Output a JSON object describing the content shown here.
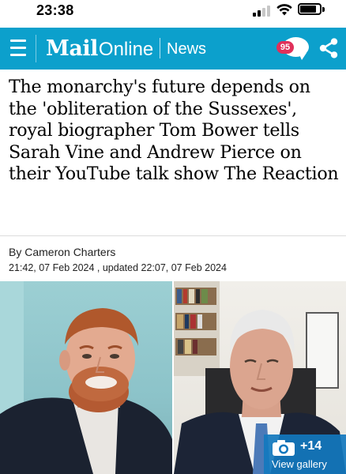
{
  "status_bar": {
    "time": "23:38"
  },
  "header": {
    "logo_bold": "Mail",
    "logo_regular": "Online",
    "section": "News",
    "comment_count": "95",
    "background_color": "#0ca0cc",
    "menu_icon": "hamburger-icon",
    "share_icon": "share-icon"
  },
  "article": {
    "headline": "The monarchy's future depends on the 'obliteration of the Sussexes', royal biographer Tom Bower tells Sarah Vine and Andrew Pierce on their YouTube talk show The Reaction",
    "byline": "By Cameron Charters",
    "dates": "21:42, 07 Feb 2024 , updated 22:07, 07 Feb 2024"
  },
  "gallery": {
    "count": "+14",
    "label": "View gallery",
    "icon": "camera-icon",
    "badge_color": "#1278be"
  }
}
